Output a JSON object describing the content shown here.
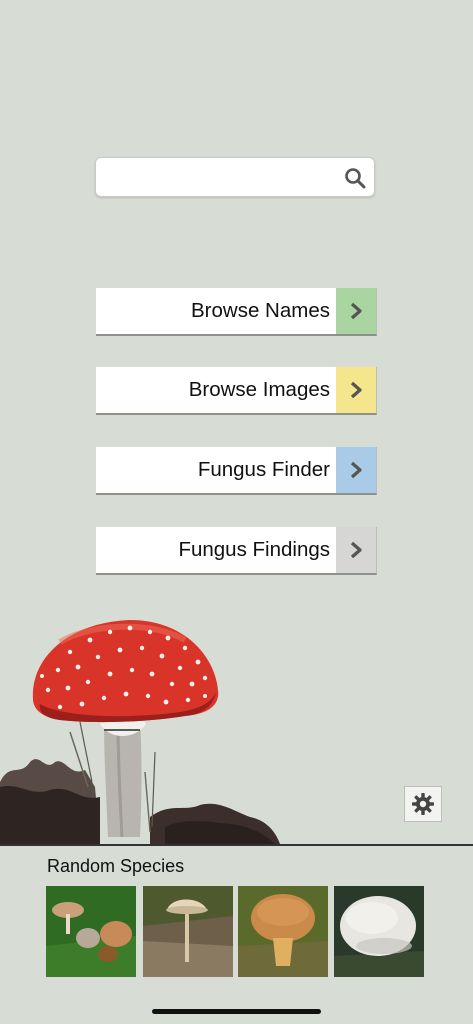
{
  "search": {
    "placeholder": "",
    "icon": "search-icon"
  },
  "nav": [
    {
      "label": "Browse Names",
      "color": "#a8d5a0"
    },
    {
      "label": "Browse Images",
      "color": "#f3e68c"
    },
    {
      "label": "Fungus Finder",
      "color": "#a9cbe8"
    },
    {
      "label": "Fungus Findings",
      "color": "#d6d6d4"
    }
  ],
  "settings": {
    "icon": "gear-icon"
  },
  "random": {
    "title": "Random Species",
    "thumbnails": [
      {
        "palette": [
          "#2f6b22",
          "#c9a07a",
          "#7a4a2a"
        ]
      },
      {
        "palette": [
          "#7a6a52",
          "#e6d5b8",
          "#4a3a2a"
        ]
      },
      {
        "palette": [
          "#5a6a2a",
          "#c98a4a",
          "#8a5a2a"
        ]
      },
      {
        "palette": [
          "#2a3a2a",
          "#e8e6e0",
          "#5a6a4a"
        ]
      }
    ]
  }
}
